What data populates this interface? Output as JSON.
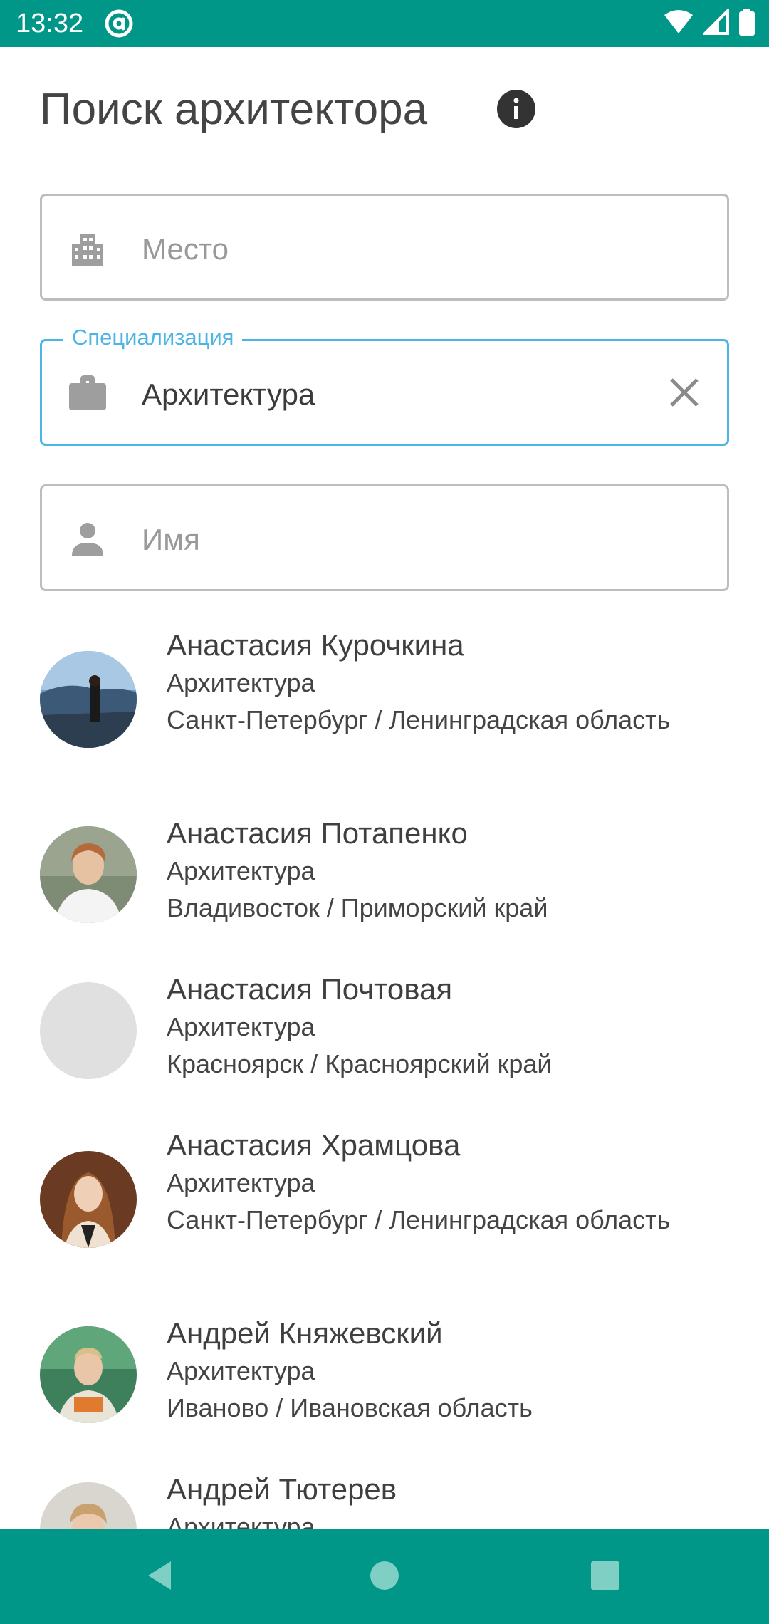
{
  "status_bar": {
    "time": "13:32",
    "app_icon": "at-circle-icon",
    "icons": [
      "wifi-icon",
      "signal-icon",
      "battery-icon"
    ],
    "color": "#009688"
  },
  "header": {
    "title": "Поиск архитектора",
    "info_icon": "info-icon"
  },
  "filters": {
    "place": {
      "icon": "city-icon",
      "placeholder": "Место",
      "value": ""
    },
    "specialization": {
      "icon": "briefcase-icon",
      "label": "Специализация",
      "value": "Архитектура",
      "clear_icon": "close-icon"
    },
    "name": {
      "icon": "person-icon",
      "placeholder": "Имя",
      "value": ""
    }
  },
  "results": [
    {
      "name": "Анастасия Курочкина",
      "specialization": "Архитектура",
      "location": "Санкт-Петербург / Ленинградская область",
      "avatar": "photo"
    },
    {
      "name": "Анастасия Потапенко",
      "specialization": "Архитектура",
      "location": "Владивосток / Приморский край",
      "avatar": "photo"
    },
    {
      "name": "Анастасия Почтовая",
      "specialization": "Архитектура",
      "location": "Красноярск / Красноярский край",
      "avatar": "placeholder"
    },
    {
      "name": "Анастасия Храмцова",
      "specialization": "Архитектура",
      "location": "Санкт-Петербург / Ленинградская область",
      "avatar": "photo"
    },
    {
      "name": "Андрей Княжевский",
      "specialization": "Архитектура",
      "location": "Иваново / Ивановская область",
      "avatar": "photo"
    },
    {
      "name": "Андрей Тютерев",
      "specialization": "Архитектура",
      "location": "",
      "avatar": "photo"
    }
  ],
  "nav_bar": {
    "buttons": [
      "back-icon",
      "home-icon",
      "recents-icon"
    ]
  },
  "colors": {
    "accent": "#4cb4e6",
    "teal": "#009688",
    "border": "#bdbdbd"
  }
}
